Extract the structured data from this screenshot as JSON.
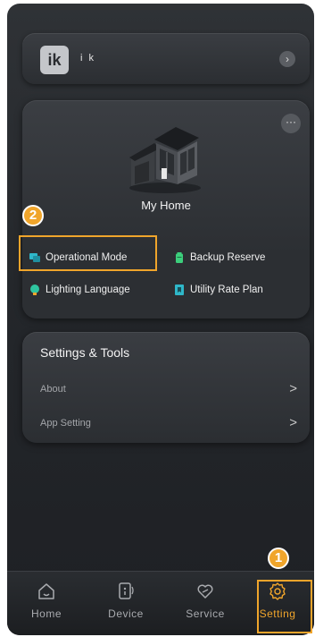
{
  "profile": {
    "avatar_initials": "ik",
    "username": "i k",
    "chevron_glyph": "›"
  },
  "home": {
    "more_glyph": "···",
    "name": "My Home",
    "actions": [
      {
        "label": "Operational Mode",
        "icon": "operational-mode-icon",
        "color": "#2fb7c9"
      },
      {
        "label": "Backup Reserve",
        "icon": "battery-icon",
        "color": "#3ccf7c"
      },
      {
        "label": "Lighting Language",
        "icon": "lighting-icon",
        "color": "#2fc5a0"
      },
      {
        "label": "Utility Rate Plan",
        "icon": "rate-plan-icon",
        "color": "#2fb7c9"
      }
    ]
  },
  "tools": {
    "title": "Settings & Tools",
    "items": [
      {
        "label": "About",
        "chevron": ">"
      },
      {
        "label": "App Setting",
        "chevron": ">"
      }
    ]
  },
  "tabs": [
    {
      "label": "Home",
      "icon": "home-icon",
      "active": false
    },
    {
      "label": "Device",
      "icon": "device-icon",
      "active": false
    },
    {
      "label": "Service",
      "icon": "service-icon",
      "active": false
    },
    {
      "label": "Setting",
      "icon": "gear-icon",
      "active": true
    }
  ],
  "annotations": {
    "step1": "1",
    "step2": "2",
    "accent_color": "#f0a52b"
  }
}
